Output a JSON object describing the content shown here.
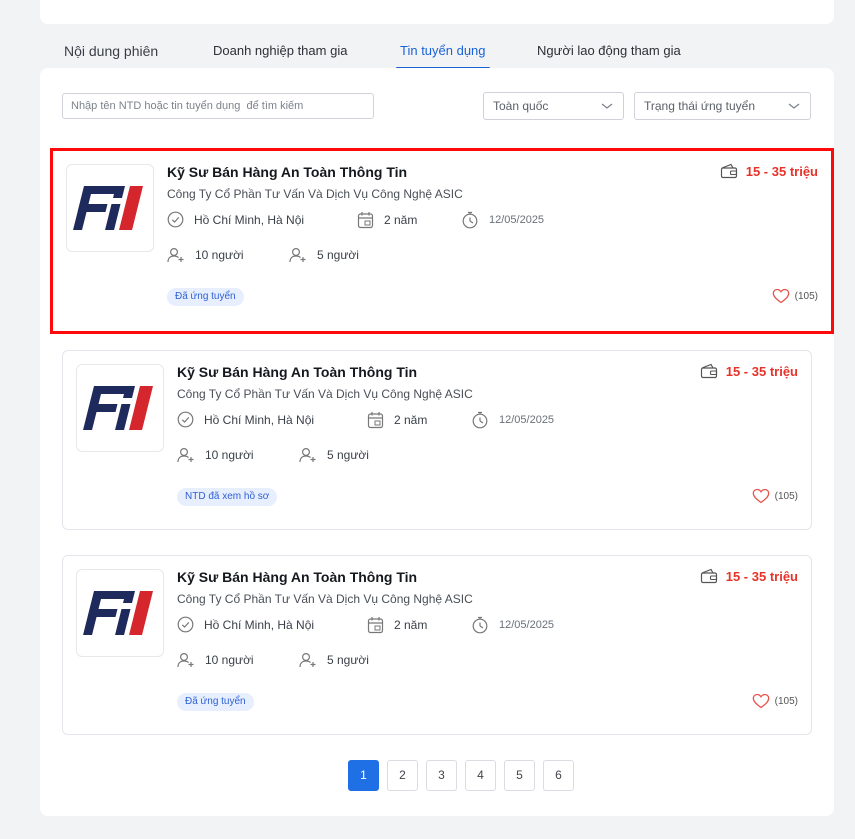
{
  "tabs": [
    {
      "label": "Nội dung phiên"
    },
    {
      "label": "Doanh nghiệp tham gia"
    },
    {
      "label": "Tin tuyển dụng"
    },
    {
      "label": "Người lao động tham gia"
    }
  ],
  "active_tab": "Tin tuyển dụng",
  "filters": {
    "search_placeholder": "Nhập tên NTD hoặc tin tuyển dụng  để tìm kiếm",
    "location": "Toàn quốc",
    "status": "Trạng thái ứng tuyển"
  },
  "jobs": [
    {
      "logo_text": "FII",
      "title": "Kỹ Sư Bán Hàng An Toàn Thông Tin",
      "company": "Công Ty Cổ Phần Tư Vấn Và Dịch Vụ Công Nghệ ASIC",
      "salary": "15 - 35 triệu",
      "location": "Hồ Chí Minh, Hà Nội",
      "experience": "2 năm",
      "deadline": "12/05/2025",
      "quantity": "10 người",
      "applied": "5 người",
      "status": "Đã ứng tuyển",
      "likes": "(105)"
    },
    {
      "logo_text": "FII",
      "title": "Kỹ Sư Bán Hàng An Toàn Thông Tin",
      "company": "Công Ty Cổ Phần Tư Vấn Và Dịch Vụ Công Nghệ ASIC",
      "salary": "15 - 35 triệu",
      "location": "Hồ Chí Minh, Hà Nội",
      "experience": "2 năm",
      "deadline": "12/05/2025",
      "quantity": "10 người",
      "applied": "5 người",
      "status": "NTD đã xem hồ sơ",
      "likes": "(105)"
    },
    {
      "logo_text": "FII",
      "title": "Kỹ Sư Bán Hàng An Toàn Thông Tin",
      "company": "Công Ty Cổ Phần Tư Vấn Và Dịch Vụ Công Nghệ ASIC",
      "salary": "15 - 35 triệu",
      "location": "Hồ Chí Minh, Hà Nội",
      "experience": "2 năm",
      "deadline": "12/05/2025",
      "quantity": "10 người",
      "applied": "5 người",
      "status": "Đã ứng tuyển",
      "likes": "(105)"
    }
  ],
  "pagination": {
    "pages": [
      "1",
      "2",
      "3",
      "4",
      "5",
      "6"
    ],
    "current": "1"
  },
  "colors": {
    "accent": "#1f6fe5",
    "salary": "#e5332a",
    "highlight_border": "#ff0a0a",
    "logo_navy": "#1f2a5c",
    "logo_red": "#d6262d"
  }
}
